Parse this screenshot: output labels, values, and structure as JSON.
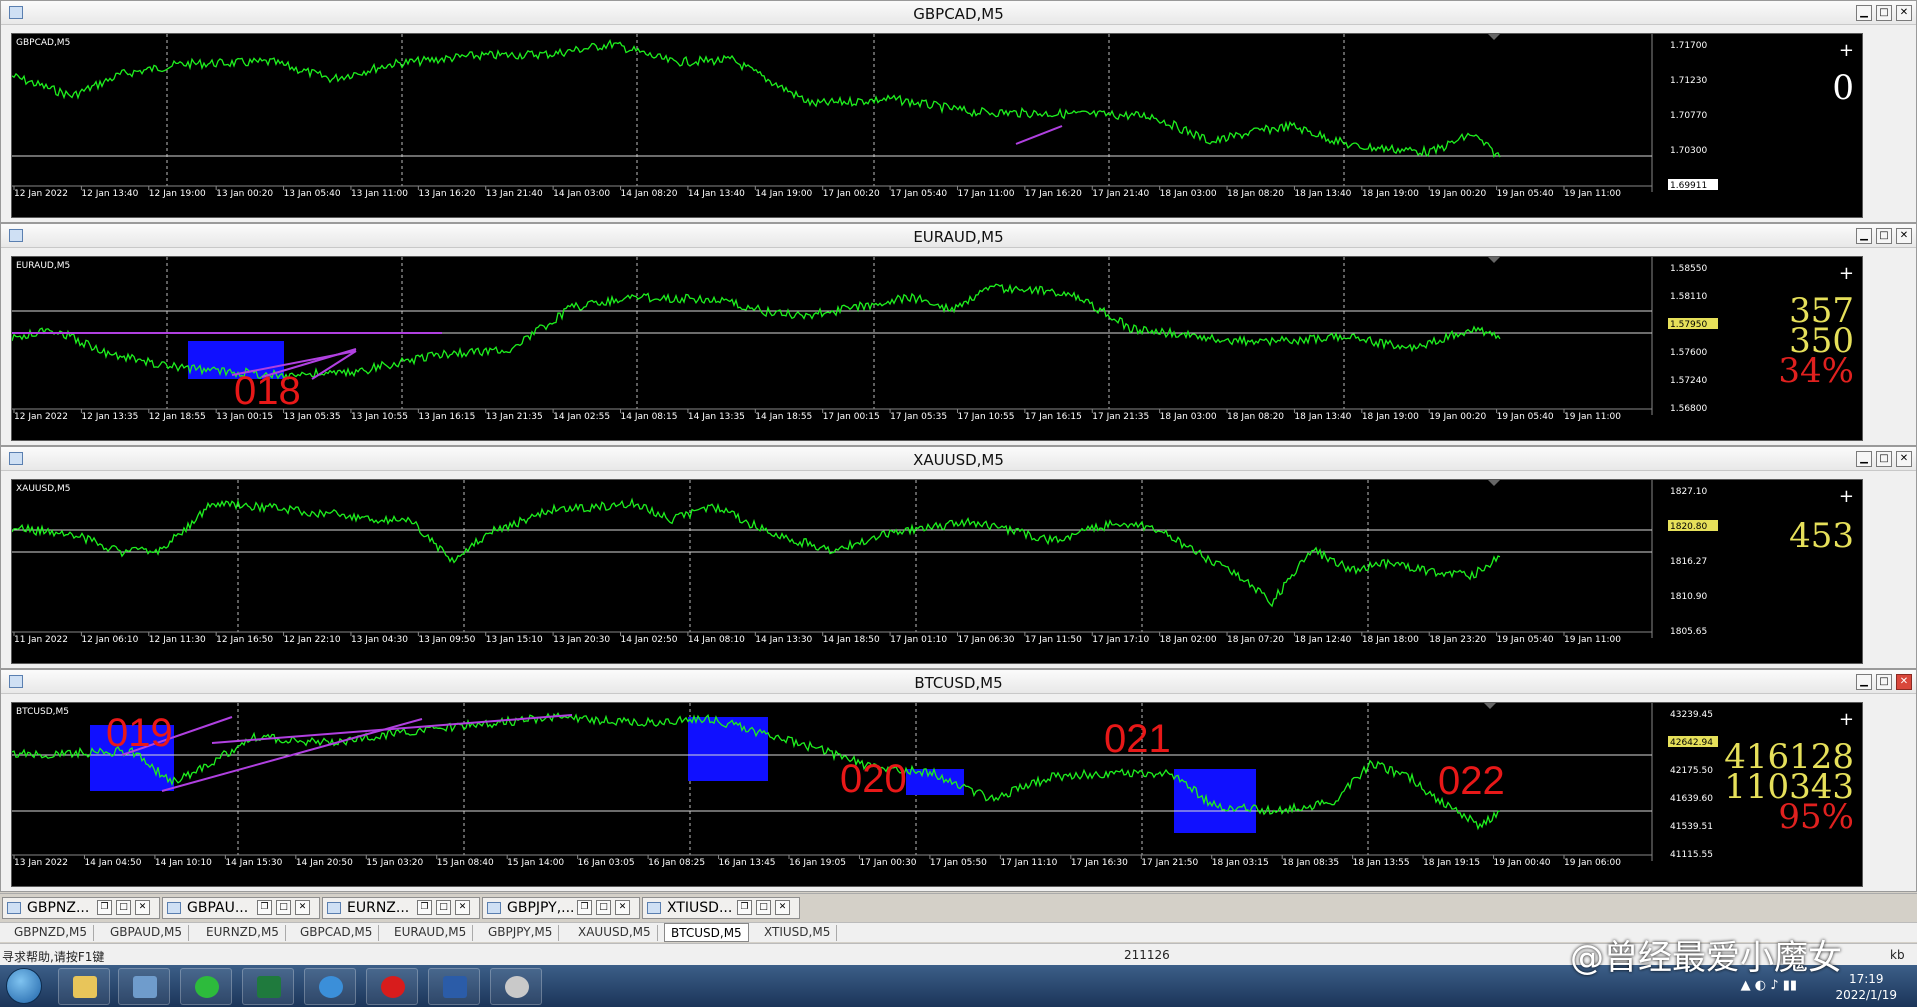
{
  "charts": [
    {
      "id": "gbpcad",
      "title": "GBPCAD,M5",
      "symbol_label": "GBPCAD,M5",
      "big_numbers": [
        {
          "text": "0",
          "color": "white"
        }
      ],
      "price_labels": [
        "1.71700",
        "1.71230",
        "1.70770",
        "1.70300",
        "1.69911"
      ],
      "highlight_price": "1.69911",
      "time_labels": [
        "12 Jan 2022",
        "12 Jan 13:40",
        "12 Jan 19:00",
        "13 Jan 00:20",
        "13 Jan 05:40",
        "13 Jan 11:00",
        "13 Jan 16:20",
        "13 Jan 21:40",
        "14 Jan 03:00",
        "14 Jan 08:20",
        "14 Jan 13:40",
        "14 Jan 19:00",
        "17 Jan 00:20",
        "17 Jan 05:40",
        "17 Jan 11:00",
        "17 Jan 16:20",
        "17 Jan 21:40",
        "18 Jan 03:00",
        "18 Jan 08:20",
        "18 Jan 13:40",
        "18 Jan 19:00",
        "19 Jan 00:20",
        "19 Jan 05:40",
        "19 Jan 11:00"
      ],
      "boxes": []
    },
    {
      "id": "euraud",
      "title": "EURAUD,M5",
      "symbol_label": "EURAUD,M5",
      "big_numbers": [
        {
          "text": "357",
          "color": "yellow"
        },
        {
          "text": "350",
          "color": "yellow"
        },
        {
          "text": "34%",
          "color": "red"
        }
      ],
      "price_labels": [
        "1.58550",
        "1.58110",
        "1.57950",
        "1.57600",
        "1.57240",
        "1.56800"
      ],
      "highlight_price": "1.57950",
      "time_labels": [
        "12 Jan 2022",
        "12 Jan 13:35",
        "12 Jan 18:55",
        "13 Jan 00:15",
        "13 Jan 05:35",
        "13 Jan 10:55",
        "13 Jan 16:15",
        "13 Jan 21:35",
        "14 Jan 02:55",
        "14 Jan 08:15",
        "14 Jan 13:35",
        "14 Jan 18:55",
        "17 Jan 00:15",
        "17 Jan 05:35",
        "17 Jan 10:55",
        "17 Jan 16:15",
        "17 Jan 21:35",
        "18 Jan 03:00",
        "18 Jan 08:20",
        "18 Jan 13:40",
        "18 Jan 19:00",
        "19 Jan 00:20",
        "19 Jan 05:40",
        "19 Jan 11:00"
      ],
      "boxes": [
        {
          "label": "018"
        }
      ]
    },
    {
      "id": "xauusd",
      "title": "XAUUSD,M5",
      "symbol_label": "XAUUSD,M5",
      "big_numbers": [
        {
          "text": "453",
          "color": "yellow"
        }
      ],
      "price_labels": [
        "1827.10",
        "1820.80",
        "1816.27",
        "1810.90",
        "1805.65"
      ],
      "highlight_price": "1820.80",
      "time_labels": [
        "11 Jan 2022",
        "12 Jan 06:10",
        "12 Jan 11:30",
        "12 Jan 16:50",
        "12 Jan 22:10",
        "13 Jan 04:30",
        "13 Jan 09:50",
        "13 Jan 15:10",
        "13 Jan 20:30",
        "14 Jan 02:50",
        "14 Jan 08:10",
        "14 Jan 13:30",
        "14 Jan 18:50",
        "17 Jan 01:10",
        "17 Jan 06:30",
        "17 Jan 11:50",
        "17 Jan 17:10",
        "18 Jan 02:00",
        "18 Jan 07:20",
        "18 Jan 12:40",
        "18 Jan 18:00",
        "18 Jan 23:20",
        "19 Jan 05:40",
        "19 Jan 11:00"
      ],
      "boxes": []
    },
    {
      "id": "btcusd",
      "title": "BTCUSD,M5",
      "symbol_label": "BTCUSD,M5",
      "big_numbers": [
        {
          "text": "416128",
          "color": "yellow"
        },
        {
          "text": "110343",
          "color": "yellow"
        },
        {
          "text": "95%",
          "color": "red"
        }
      ],
      "price_labels": [
        "43239.45",
        "42642.94",
        "42175.50",
        "41639.60",
        "41539.51",
        "41115.55"
      ],
      "highlight_price": "42642.94",
      "time_labels": [
        "13 Jan 2022",
        "14 Jan 04:50",
        "14 Jan 10:10",
        "14 Jan 15:30",
        "14 Jan 20:50",
        "15 Jan 03:20",
        "15 Jan 08:40",
        "15 Jan 14:00",
        "16 Jan 03:05",
        "16 Jan 08:25",
        "16 Jan 13:45",
        "16 Jan 19:05",
        "17 Jan 00:30",
        "17 Jan 05:50",
        "17 Jan 11:10",
        "17 Jan 16:30",
        "17 Jan 21:50",
        "18 Jan 03:15",
        "18 Jan 08:35",
        "18 Jan 13:55",
        "18 Jan 19:15",
        "19 Jan 00:40",
        "19 Jan 06:00"
      ],
      "boxes": [
        {
          "label": "019"
        },
        {
          "label": "020"
        },
        {
          "label": "021"
        },
        {
          "label": "022"
        }
      ]
    }
  ],
  "min_tabs": [
    "GBPNZ...",
    "GBPAU...",
    "EURNZ...",
    "GBPJPY,...",
    "XTIUSD..."
  ],
  "bottom_tabs": [
    {
      "label": "GBPNZD,M5",
      "active": false
    },
    {
      "label": "GBPAUD,M5",
      "active": false
    },
    {
      "label": "EURNZD,M5",
      "active": false
    },
    {
      "label": "GBPCAD,M5",
      "active": false
    },
    {
      "label": "EURAUD,M5",
      "active": false
    },
    {
      "label": "GBPJPY,M5",
      "active": false
    },
    {
      "label": "XAUUSD,M5",
      "active": false
    },
    {
      "label": "BTCUSD,M5",
      "active": true
    },
    {
      "label": "XTIUSD,M5",
      "active": false
    }
  ],
  "status": {
    "help": "寻求帮助,请按F1键",
    "bars": "211126",
    "kb": "kb"
  },
  "taskbar": {
    "time": "17:19",
    "date": "2022/1/19"
  },
  "watermark": "@曾经最爱小魔女",
  "colors": {
    "price_line": "#1ef01e",
    "trendline": "#b040e0",
    "box": "#1010ff",
    "label_red": "#e81818",
    "number_yellow": "#e6e05a",
    "background": "#000000"
  }
}
